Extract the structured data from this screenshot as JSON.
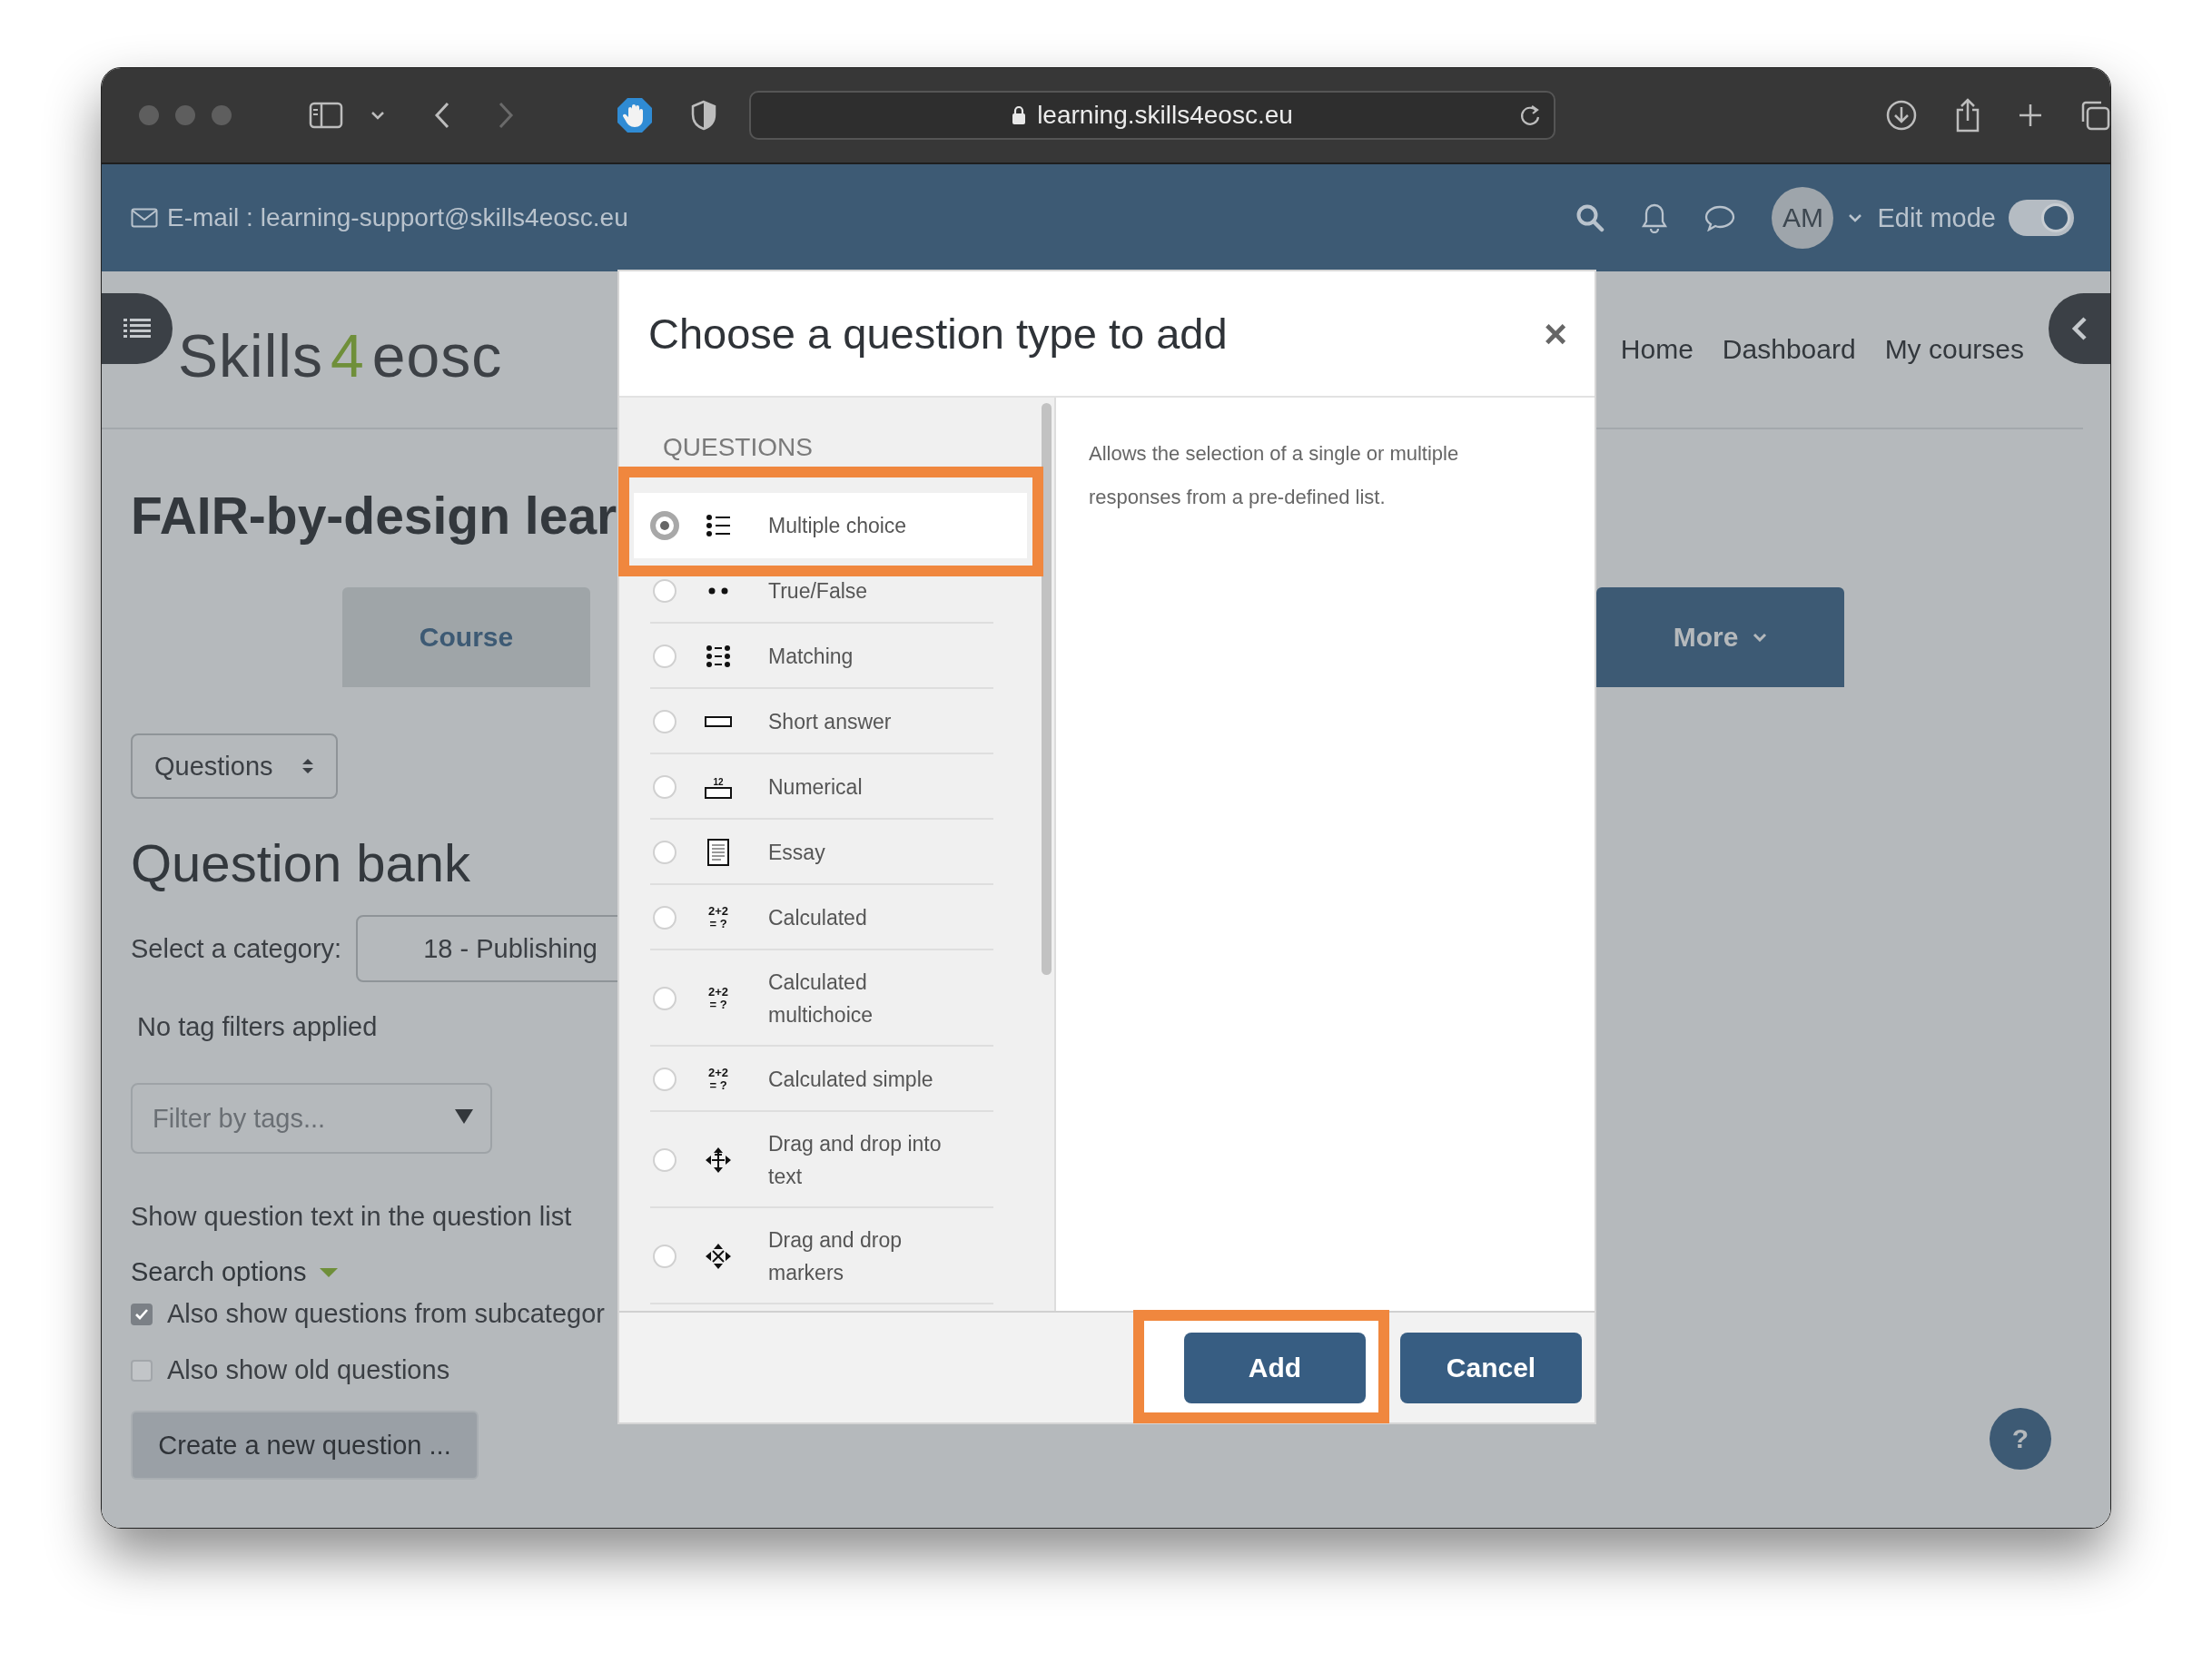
{
  "browser": {
    "url": "learning.skills4eosc.eu"
  },
  "header": {
    "email_label": "E-mail : learning-support@skills4eosc.eu",
    "avatar": "AM",
    "edit_mode": {
      "label": "Edit mode",
      "on": true
    }
  },
  "logo": [
    {
      "text": "Skills",
      "color": "#3d4146"
    },
    {
      "text": "4",
      "color": "#6f8f3a"
    },
    {
      "text": "eosc",
      "color": "#3d4146"
    }
  ],
  "nav": [
    "Home",
    "Dashboard",
    "My courses"
  ],
  "course": {
    "title": "FAIR-by-design lear",
    "tabs": [
      {
        "label": "Course",
        "kind": "tab"
      },
      {
        "label": "More",
        "kind": "menu"
      }
    ]
  },
  "question_bank": {
    "view_select": "Questions",
    "heading": "Question bank",
    "category_label": "Select a category:",
    "category_value": "18 - Publishing",
    "tag_status": "No tag filters applied",
    "tag_filter": {
      "placeholder": "Filter by tags..."
    },
    "show_text_label": "Show question text in the question list",
    "search_options": "Search options",
    "options": [
      {
        "label": "Also show questions from subcategor",
        "checked": true
      },
      {
        "label": "Also show old questions",
        "checked": false
      }
    ],
    "create_button": "Create a new question ..."
  },
  "help_button": "?",
  "dialog": {
    "title": "Choose a question type to add",
    "close": "×",
    "section": "QUESTIONS",
    "types": [
      {
        "label": "Multiple choice",
        "kind": "multichoice",
        "selected": true,
        "highlighted": true
      },
      {
        "label": "True/False",
        "kind": "truefalse",
        "selected": false,
        "highlighted": false
      },
      {
        "label": "Matching",
        "kind": "match",
        "selected": false,
        "highlighted": false
      },
      {
        "label": "Short answer",
        "kind": "shortanswer",
        "selected": false,
        "highlighted": false
      },
      {
        "label": "Numerical",
        "kind": "numerical",
        "icon_text": [
          "12"
        ],
        "selected": false,
        "highlighted": false
      },
      {
        "label": "Essay",
        "kind": "essay",
        "selected": false,
        "highlighted": false
      },
      {
        "label": "Calculated",
        "kind": "calculated",
        "icon_text": [
          "2+2",
          "= ?"
        ],
        "selected": false,
        "highlighted": false
      },
      {
        "label": "Calculated multichoice",
        "kind": "calculated",
        "icon_text": [
          "2+2",
          "= ?"
        ],
        "selected": false,
        "highlighted": false
      },
      {
        "label": "Calculated simple",
        "kind": "calculated",
        "icon_text": [
          "2+2",
          "= ?"
        ],
        "selected": false,
        "highlighted": false
      },
      {
        "label": "Drag and drop into text",
        "kind": "dragtext",
        "selected": false,
        "highlighted": false
      },
      {
        "label": "Drag and drop markers",
        "kind": "dragmarker",
        "selected": false,
        "highlighted": false
      }
    ],
    "description": "Allows the selection of a single or multiple responses from a pre-defined list.",
    "buttons": [
      {
        "label": "Add",
        "highlighted": true
      },
      {
        "label": "Cancel",
        "highlighted": false
      }
    ]
  }
}
